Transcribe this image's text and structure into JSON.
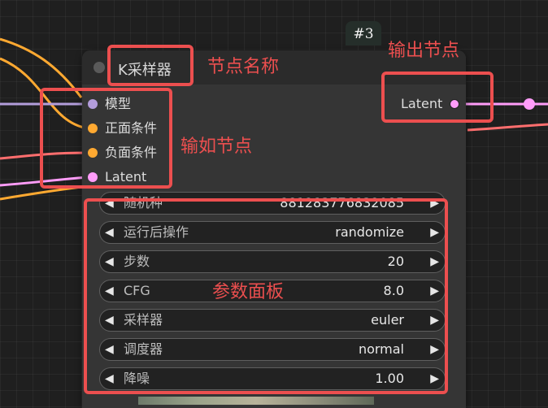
{
  "node": {
    "title": "K采样器",
    "id_badge": "#3",
    "inputs": [
      {
        "label": "模型",
        "color": "#b39ddb"
      },
      {
        "label": "正面条件",
        "color": "#ffa931"
      },
      {
        "label": "负面条件",
        "color": "#ffa931"
      },
      {
        "label": "Latent",
        "color": "#ff9cf9"
      }
    ],
    "output": {
      "label": "Latent",
      "color": "#ff9cf9"
    },
    "widgets": [
      {
        "name": "随机种",
        "value": "881283776832085"
      },
      {
        "name": "运行后操作",
        "value": "randomize"
      },
      {
        "name": "步数",
        "value": "20"
      },
      {
        "name": "CFG",
        "value": "8.0"
      },
      {
        "name": "采样器",
        "value": "euler"
      },
      {
        "name": "调度器",
        "value": "normal"
      },
      {
        "name": "降噪",
        "value": "1.00"
      }
    ],
    "arrow_left": "◀",
    "arrow_right": "▶"
  },
  "annotations": {
    "node_name": "节点名称",
    "output_node": "输出节点",
    "input_node": "输如节点",
    "param_panel": "参数面板",
    "color": "#ec4f4f"
  },
  "wire_colors": {
    "model": "#b39ddb",
    "conditioning": "#ffa931",
    "negative": "#ff6e6e",
    "latent": "#ff9cf9"
  }
}
